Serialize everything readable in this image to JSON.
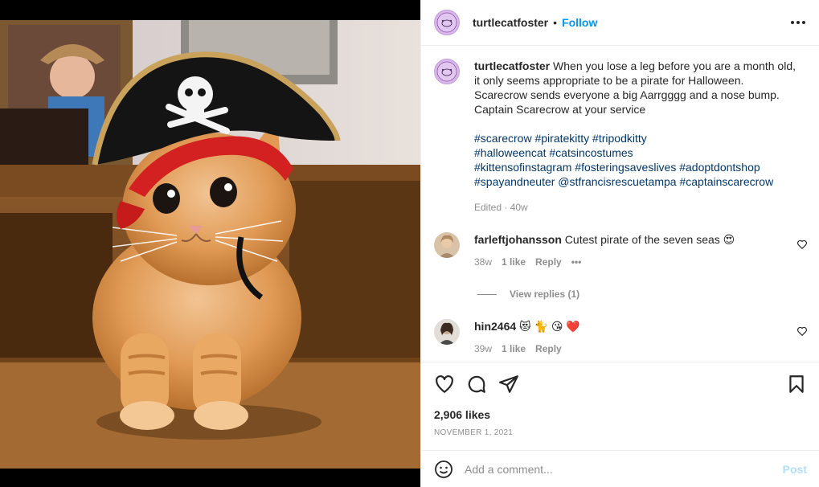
{
  "post": {
    "image_alt": "Orange kitten wearing a pirate hat",
    "image_hat_emblem": "skull-and-crossbones"
  },
  "header": {
    "username": "turtlecatfoster",
    "separator": "•",
    "follow_label": "Follow",
    "more_icon": "more-horizontal-icon"
  },
  "caption": {
    "username": "turtlecatfoster",
    "lines": [
      "When you lose a leg before you are a month old,",
      "it only seems appropriate to be a pirate for Halloween.",
      "Scarecrow sends everyone a big Aarrgggg and a nose bump.",
      "Captain Scarecrow at your service"
    ],
    "hashtags": [
      "#scarecrow #piratekitty #tripodkitty",
      "#halloweencat #catsincostumes",
      "#kittensofinstagram #fosteringsaveslives #adoptdontshop",
      "#spayandneuter @stfrancisrescuetampa #captainscarecrow"
    ],
    "edited": "Edited · 40w"
  },
  "comments": [
    {
      "username": "farleftjohansson",
      "text": "Cutest pirate of the seven seas 😍",
      "time": "38w",
      "likes": "1 like",
      "reply": "Reply",
      "more": "•••"
    },
    {
      "username": "hin2464",
      "text": "😻 🐈 😘 ❤️",
      "time": "39w",
      "likes": "1 like",
      "reply": "Reply"
    }
  ],
  "view_replies": "View replies (1)",
  "actions": {
    "likes": "2,906 likes",
    "date": "NOVEMBER 1, 2021"
  },
  "add_comment": {
    "placeholder": "Add a comment...",
    "post_label": "Post"
  },
  "colors": {
    "link": "#0095f6",
    "hashtag": "#00376b",
    "muted": "#8e8e8e",
    "post_disabled": "#b2dffc",
    "like_red": "#ed4956"
  }
}
